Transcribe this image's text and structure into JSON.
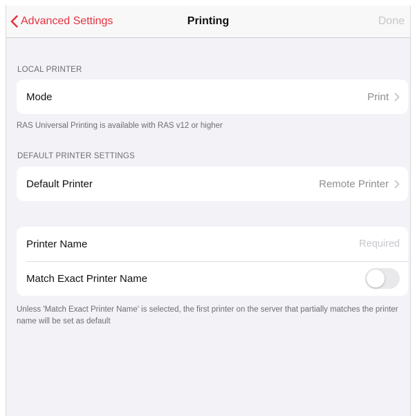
{
  "nav": {
    "back_label": "Advanced Settings",
    "title": "Printing",
    "done_label": "Done"
  },
  "local_printer": {
    "header": "LOCAL PRINTER",
    "mode_label": "Mode",
    "mode_value": "Print",
    "footer": "RAS Universal Printing is available with RAS v12 or higher"
  },
  "default_printer_settings": {
    "header": "DEFAULT PRINTER SETTINGS",
    "default_printer_label": "Default Printer",
    "default_printer_value": "Remote Printer"
  },
  "printer_name": {
    "label": "Printer Name",
    "placeholder": "Required",
    "value": ""
  },
  "match_exact": {
    "label": "Match Exact Printer Name",
    "enabled": false,
    "footer": "Unless 'Match Exact Printer Name' is selected, the first printer on the server that partially matches the printer name will be set as default"
  },
  "colors": {
    "accent": "#e5323f",
    "background": "#f2f2f7",
    "secondary_text": "#8e8e93",
    "disabled": "#c7c7cc"
  },
  "icons": {
    "back": "chevron-left-icon",
    "disclosure": "chevron-right-icon"
  }
}
